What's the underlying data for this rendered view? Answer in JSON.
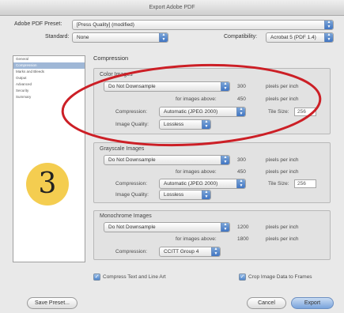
{
  "window": {
    "title": "Export Adobe PDF"
  },
  "header": {
    "preset_label": "Adobe PDF Preset:",
    "preset_value": "[Press Quality] (modified)",
    "standard_label": "Standard:",
    "standard_value": "None",
    "compat_label": "Compatibility:",
    "compat_value": "Acrobat 5 (PDF 1.4)"
  },
  "sidebar": {
    "items": [
      {
        "label": "General"
      },
      {
        "label": "Compression"
      },
      {
        "label": "Marks and Bleeds"
      },
      {
        "label": "Output"
      },
      {
        "label": "Advanced"
      },
      {
        "label": "Security"
      },
      {
        "label": "Summary"
      }
    ],
    "selected_index": 1
  },
  "compression": {
    "heading": "Compression",
    "color": {
      "title": "Color Images",
      "downsample": "Do Not Downsample",
      "ppi_value": "300",
      "ppi_label": "pixels per inch",
      "above_label": "for images above:",
      "above_value": "450",
      "above_unit": "pixels per inch",
      "compression_label": "Compression:",
      "compression_value": "Automatic (JPEG 2000)",
      "tile_label": "Tile Size:",
      "tile_value": "256",
      "quality_label": "Image Quality:",
      "quality_value": "Lossless"
    },
    "grayscale": {
      "title": "Grayscale Images",
      "downsample": "Do Not Downsample",
      "ppi_value": "300",
      "ppi_label": "pixels per inch",
      "above_label": "for images above:",
      "above_value": "450",
      "above_unit": "pixels per inch",
      "compression_label": "Compression:",
      "compression_value": "Automatic (JPEG 2000)",
      "tile_label": "Tile Size:",
      "tile_value": "256",
      "quality_label": "Image Quality:",
      "quality_value": "Lossless"
    },
    "mono": {
      "title": "Monochrome Images",
      "downsample": "Do Not Downsample",
      "ppi_value": "1200",
      "ppi_label": "pixels per inch",
      "above_label": "for images above:",
      "above_value": "1800",
      "above_unit": "pixels per inch",
      "compression_label": "Compression:",
      "compression_value": "CCITT Group 4"
    },
    "compress_text_label": "Compress Text and Line Art",
    "crop_label": "Crop Image Data to Frames"
  },
  "footer": {
    "save_preset_label": "Save Preset...",
    "cancel_label": "Cancel",
    "export_label": "Export"
  },
  "overlay": {
    "step_number": "3",
    "badge_color": "#f4cd50",
    "ellipse_color": "#cc1f26"
  }
}
